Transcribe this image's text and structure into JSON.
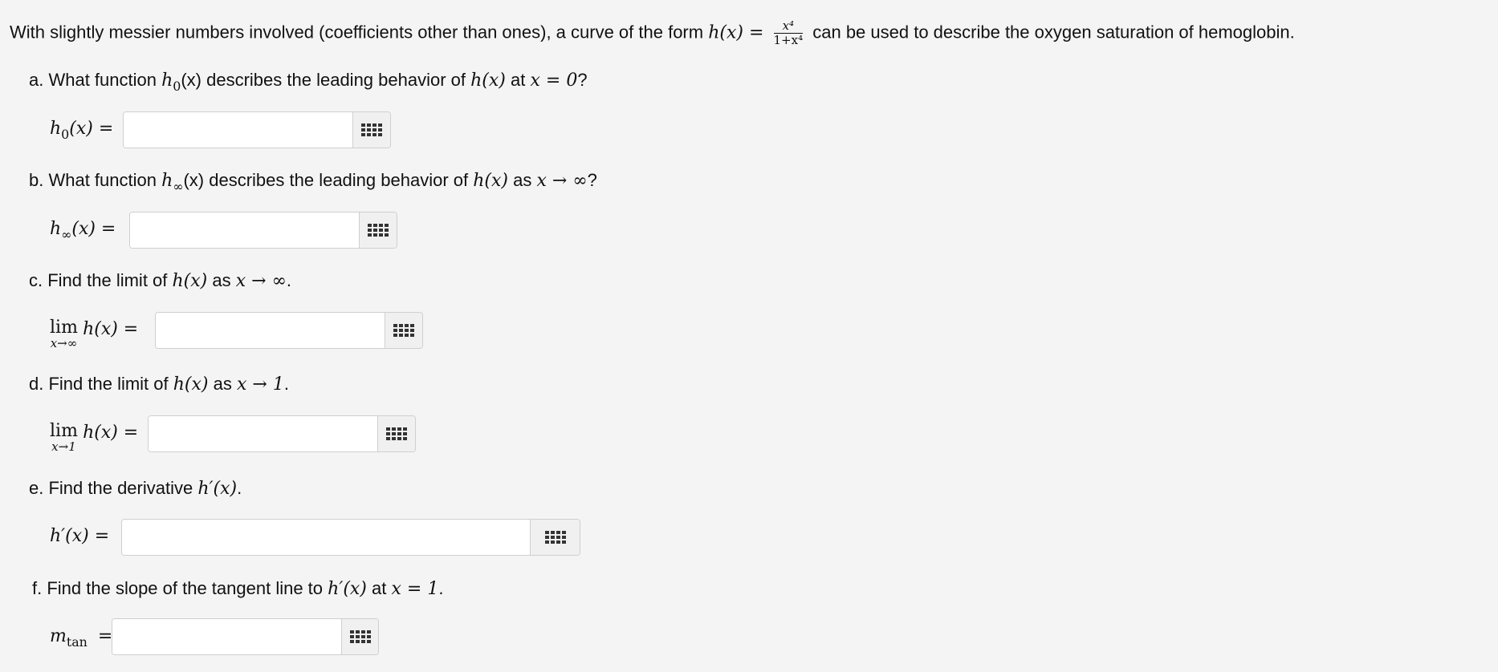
{
  "intro": {
    "before": "With slightly messier numbers involved (coefficients other than ones), a curve of the form",
    "lhs": "h(x) =",
    "frac_num": "x⁴",
    "frac_den": "1+x⁴",
    "after": "can be used to describe the oxygen saturation of hemoglobin."
  },
  "questions": [
    {
      "letter": "a. What function",
      "f": "h",
      "fsub": "0",
      "mid": "(x) describes the leading behavior of",
      "h": "h(x)",
      "tail_text": "at",
      "tail_math": "x = 0",
      "end": "?"
    },
    {
      "letter": "b. What function",
      "f": "h",
      "fsub": "∞",
      "mid": "(x) describes the leading behavior of",
      "h": "h(x)",
      "tail_text": "as",
      "tail_math": "x → ∞",
      "end": "?"
    },
    {
      "letter": "c. Find the limit of",
      "h": "h(x)",
      "tail_text": "as",
      "tail_math": "x → ∞",
      "end": "."
    },
    {
      "letter": "d. Find the limit of",
      "h": "h(x)",
      "tail_text": "as",
      "tail_math": "x → 1",
      "end": "."
    },
    {
      "letter": "e. Find the derivative",
      "h": "h′(x)",
      "end": "."
    },
    {
      "letter": "f. Find the slope of the tangent line to",
      "h": "h′(x)",
      "tail_text": "at",
      "tail_math": "x = 1",
      "end": "."
    }
  ],
  "answers": {
    "a": {
      "f": "h",
      "sub": "0",
      "rest": "(x) =",
      "value": ""
    },
    "b": {
      "f": "h",
      "sub": "∞",
      "rest": "(x) =",
      "value": ""
    },
    "c": {
      "lim": "lim",
      "under": "x→∞",
      "rest": "h(x) =",
      "value": ""
    },
    "d": {
      "lim": "lim",
      "under": "x→1",
      "rest": "h(x) =",
      "value": ""
    },
    "e": {
      "lhs": "h′(x) =",
      "value": ""
    },
    "f": {
      "f": "m",
      "sub": "tan",
      "rest": "=",
      "value": ""
    }
  },
  "icons": {
    "keypad": "keypad-grid-icon"
  }
}
